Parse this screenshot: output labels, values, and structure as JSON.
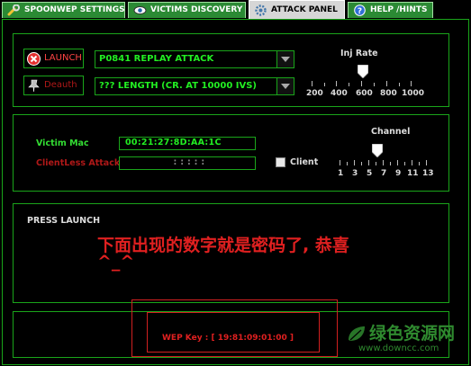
{
  "tabs": [
    {
      "label": "SPOONWEP SETTINGS",
      "icon": "wrench-icon"
    },
    {
      "label": "VICTIMS DISCOVERY",
      "icon": "eye-icon"
    },
    {
      "label": "ATTACK PANEL",
      "icon": "gear-icon"
    },
    {
      "label": "HELP /HINTS",
      "icon": "help-icon"
    }
  ],
  "attack": {
    "launch_label": "LAUNCH",
    "deauth_label": "Deauth",
    "attack_type": "P0841 REPLAY ATTACK",
    "length_option": "??? LENGTH (CR. AT 10000 IVS)",
    "inj_rate_label": "Inj Rate",
    "inj_rate_ticks": [
      "200",
      "400",
      "600",
      "800",
      "1000"
    ],
    "inj_rate_value": "600"
  },
  "victim": {
    "mac_label": "Victim Mac",
    "mac_value": "00:21:27:8D:AA:1C",
    "clientless_label": "ClientLess Attack",
    "clientless_value": ": : : : :",
    "client_label": "Client",
    "client_checked": false,
    "channel_label": "Channel",
    "channel_ticks": [
      "1",
      "3",
      "5",
      "7",
      "9",
      "11",
      "13"
    ],
    "channel_value": "6"
  },
  "status": {
    "text": "PRESS LAUNCH",
    "annotation": "下面出现的数字就是密码了, 恭喜",
    "annotation_tail": "^_^"
  },
  "result": {
    "wep_key_text": "WEP Key : [ 19:81:09:01:00 ]"
  },
  "watermark": {
    "title": "绿色资源网",
    "url": "www.downcc.com"
  },
  "colors": {
    "panel_border": "#1aa51a",
    "tab_green": "#2b8a34",
    "label_green": "#33dd33",
    "warning_red": "#e02020"
  }
}
